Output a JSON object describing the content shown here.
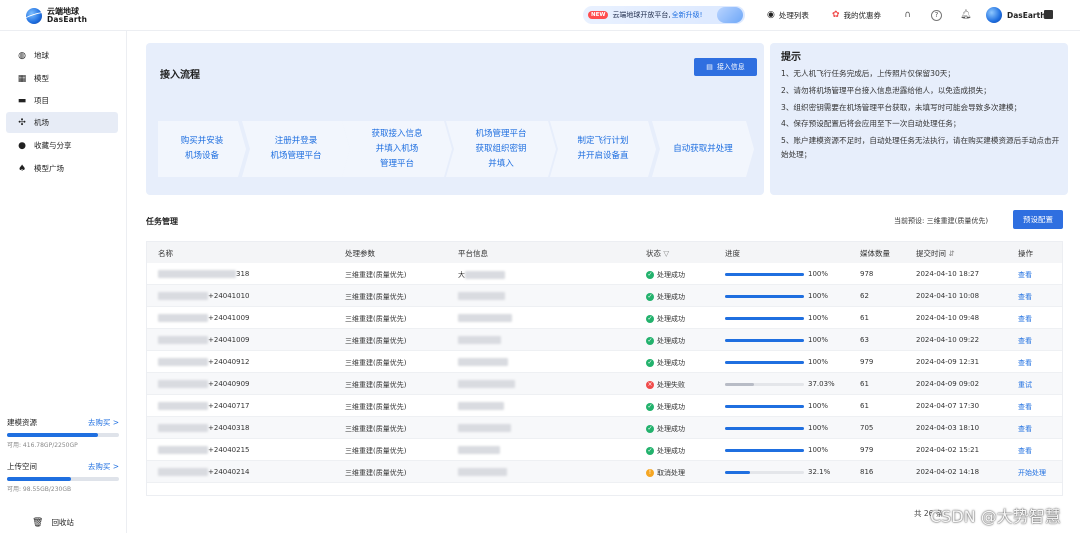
{
  "app": {
    "name_cn": "云端地球",
    "name_en": "DasEarth"
  },
  "topbar": {
    "promo_badge": "NEW",
    "promo_text": "云端地球开放平台,",
    "promo_link": "全新升级!",
    "task_list": "处理列表",
    "coupons": "我的优惠券",
    "username": "DasEarth"
  },
  "sidebar": {
    "items": [
      {
        "label": "地球",
        "icon": "compass-icon"
      },
      {
        "label": "模型",
        "icon": "grid-icon"
      },
      {
        "label": "项目",
        "icon": "folder-icon"
      },
      {
        "label": "机场",
        "icon": "drone-icon",
        "active": true
      },
      {
        "label": "收藏与分享",
        "icon": "user-icon"
      },
      {
        "label": "模型广场",
        "icon": "flame-icon"
      }
    ],
    "resources": [
      {
        "title": "建模资源",
        "buy": "去购买 >",
        "stat": "可用: 416.78GP/2250GP",
        "percent": 0.81
      },
      {
        "title": "上传空间",
        "buy": "去购买 >",
        "stat": "可用: 98.55GB/230GB",
        "percent": 0.57
      }
    ],
    "recycle": "回收站"
  },
  "flow": {
    "title": "接入流程",
    "access_button": "接入信息",
    "steps": [
      "购买并安装\n机场设备",
      "注册并登录\n机场管理平台",
      "获取接入信息\n并填入机场\n管理平台",
      "机场管理平台\n获取组织密钥\n并填入",
      "制定飞行计划\n并开启设备直",
      "自动获取并处理"
    ]
  },
  "tips": {
    "title": "提示",
    "items": [
      "1、无人机飞行任务完成后，上传照片仅保留30天；",
      "2、请勿将机场管理平台接入信息泄露给他人，以免造成损失；",
      "3、组织密钥需要在机场管理平台获取，未填写时可能会导致多次建模；",
      "4、保存预设配置后将会应用至下一次自动处理任务；",
      "5、账户建模资源不足时，自动处理任务无法执行，请在购买建模资源后手动点击开始处理；"
    ]
  },
  "tasks": {
    "title": "任务管理",
    "preset_label": "当前预设: 三维重建(质量优先)",
    "preset_button": "预设配置",
    "columns": [
      "名称",
      "处理参数",
      "平台信息",
      "状态",
      "进度",
      "媒体数量",
      "提交时间",
      "操作"
    ],
    "rows": [
      {
        "name": "318",
        "param": "三维重建(质量优先)",
        "platform": "大",
        "status": "处理成功",
        "state": "ok",
        "progress": 100,
        "progress_text": "100%",
        "media": "978",
        "time": "2024-04-10 18:27",
        "action": "查看"
      },
      {
        "name": "+24041010",
        "param": "三维重建(质量优先)",
        "platform": "",
        "status": "处理成功",
        "state": "ok",
        "progress": 100,
        "progress_text": "100%",
        "media": "62",
        "time": "2024-04-10 10:08",
        "action": "查看"
      },
      {
        "name": "+24041009",
        "param": "三维重建(质量优先)",
        "platform": "",
        "status": "处理成功",
        "state": "ok",
        "progress": 100,
        "progress_text": "100%",
        "media": "61",
        "time": "2024-04-10 09:48",
        "action": "查看"
      },
      {
        "name": "+24041009",
        "param": "三维重建(质量优先)",
        "platform": "",
        "status": "处理成功",
        "state": "ok",
        "progress": 100,
        "progress_text": "100%",
        "media": "63",
        "time": "2024-04-10 09:22",
        "action": "查看"
      },
      {
        "name": "+24040912",
        "param": "三维重建(质量优先)",
        "platform": "",
        "status": "处理成功",
        "state": "ok",
        "progress": 100,
        "progress_text": "100%",
        "media": "979",
        "time": "2024-04-09 12:31",
        "action": "查看"
      },
      {
        "name": "+24040909",
        "param": "三维重建(质量优先)",
        "platform": "",
        "status": "处理失败",
        "state": "fail",
        "progress": 37.03,
        "progress_text": "37.03%",
        "media": "61",
        "time": "2024-04-09 09:02",
        "action": "重试"
      },
      {
        "name": "+24040717",
        "param": "三维重建(质量优先)",
        "platform": "",
        "status": "处理成功",
        "state": "ok",
        "progress": 100,
        "progress_text": "100%",
        "media": "61",
        "time": "2024-04-07 17:30",
        "action": "查看"
      },
      {
        "name": "+24040318",
        "param": "三维重建(质量优先)",
        "platform": "",
        "status": "处理成功",
        "state": "ok",
        "progress": 100,
        "progress_text": "100%",
        "media": "705",
        "time": "2024-04-03 18:10",
        "action": "查看"
      },
      {
        "name": "+24040215",
        "param": "三维重建(质量优先)",
        "platform": "",
        "status": "处理成功",
        "state": "ok",
        "progress": 100,
        "progress_text": "100%",
        "media": "979",
        "time": "2024-04-02 15:21",
        "action": "查看"
      },
      {
        "name": "+24040214",
        "param": "三维重建(质量优先)",
        "platform": "",
        "status": "取消处理",
        "state": "cancel",
        "progress": 32.1,
        "progress_text": "32.1%",
        "media": "816",
        "time": "2024-04-02 14:18",
        "action": "开始处理"
      }
    ],
    "total": "共 26 条"
  },
  "watermark": "CSDN @大势智慧",
  "colors": {
    "accent": "#1f6fe0",
    "success": "#23b26d",
    "fail": "#f04b4b",
    "cancel": "#f5a623",
    "panel_bg": "#e7eefb"
  }
}
